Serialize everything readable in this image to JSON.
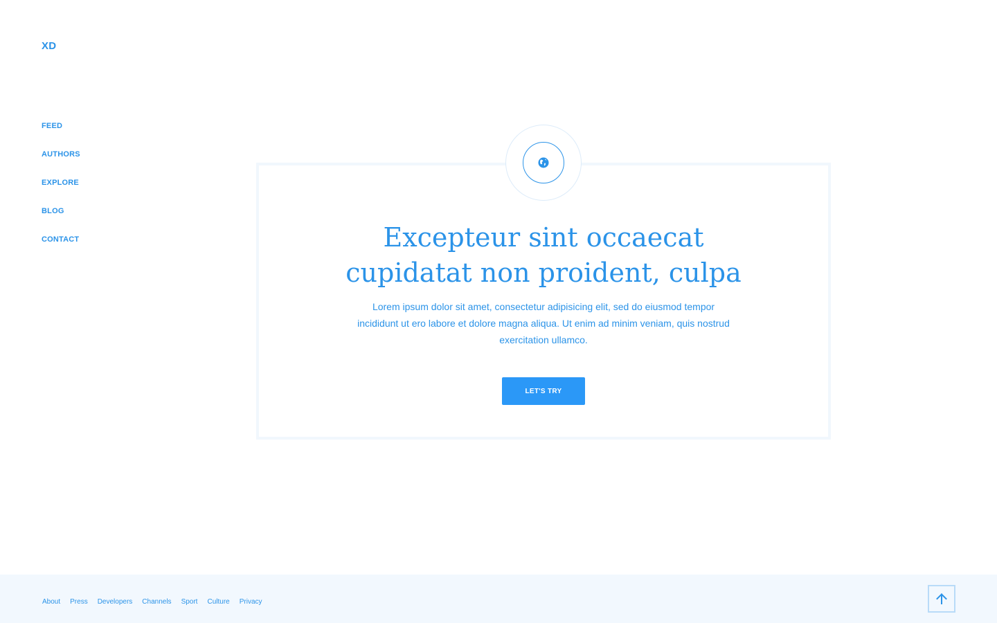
{
  "brand": {
    "logo": "XD"
  },
  "nav": {
    "items": [
      {
        "label": "FEED"
      },
      {
        "label": "AUTHORS"
      },
      {
        "label": "EXPLORE"
      },
      {
        "label": "BLOG"
      },
      {
        "label": "CONTACT"
      }
    ]
  },
  "hero": {
    "icon": "globe-icon",
    "title_line1": "Excepteur sint occaecat",
    "title_line2": "cupidatat non proident, culpa",
    "text_line1": "Lorem ipsum dolor sit amet, consectetur adipisicing elit, sed do eiusmod tempor",
    "text_line2": "incididunt ut ero labore et dolore magna aliqua. Ut enim ad minim veniam, quis nostrud",
    "text_line3": "exercitation ullamco.",
    "cta_label": "LET'S TRY"
  },
  "footer": {
    "links": [
      {
        "label": "About"
      },
      {
        "label": "Press"
      },
      {
        "label": "Developers"
      },
      {
        "label": "Channels"
      },
      {
        "label": "Sport"
      },
      {
        "label": "Culture"
      },
      {
        "label": "Privacy"
      }
    ],
    "to_top_icon": "arrow-up-icon"
  },
  "colors": {
    "accent": "#2b93e8",
    "button": "#2b98f7",
    "footer_bg": "#f2f8fe",
    "card_border": "#f1f7fd"
  }
}
